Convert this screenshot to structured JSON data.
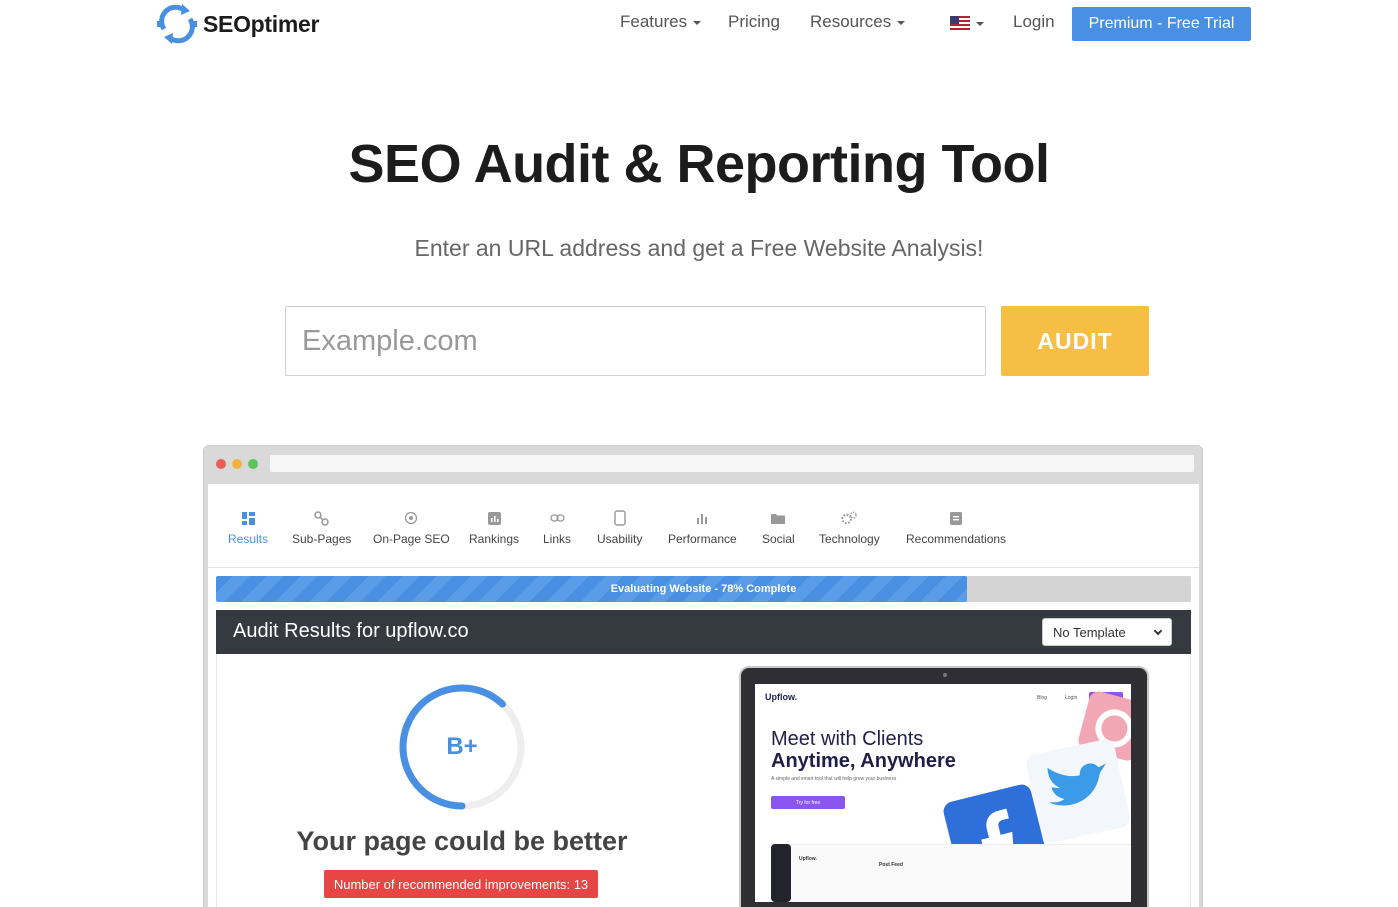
{
  "nav": {
    "logo_text": "SEOptimer",
    "features": "Features",
    "pricing": "Pricing",
    "resources": "Resources",
    "login": "Login",
    "premium": "Premium - Free Trial"
  },
  "hero": {
    "title": "SEO Audit & Reporting Tool",
    "subtitle": "Enter an URL address and get a Free Website Analysis!",
    "input_placeholder": "Example.com",
    "audit_label": "AUDIT"
  },
  "mock": {
    "tabs": [
      {
        "label": "Results",
        "icon": "dashboard-icon",
        "active": true
      },
      {
        "label": "Sub-Pages",
        "icon": "link-nodes-icon"
      },
      {
        "label": "On-Page SEO",
        "icon": "target-icon"
      },
      {
        "label": "Rankings",
        "icon": "bar-chart-icon"
      },
      {
        "label": "Links",
        "icon": "chain-link-icon"
      },
      {
        "label": "Usability",
        "icon": "tablet-icon"
      },
      {
        "label": "Performance",
        "icon": "signal-bars-icon"
      },
      {
        "label": "Social",
        "icon": "folder-icon"
      },
      {
        "label": "Technology",
        "icon": "gears-icon"
      },
      {
        "label": "Recommendations",
        "icon": "clipboard-icon"
      }
    ],
    "progress_text": "Evaluating Website - 78% Complete",
    "progress_value": 0.77,
    "results_title": "Audit Results for upflow.co",
    "template_select": "No Template",
    "grade": "B+",
    "grade_fraction": 0.62,
    "verdict": "Your page could be better",
    "improvements": "Number of recommended improvements: 13",
    "upflow": {
      "logo": "Upflow.",
      "nav_blog": "Blog",
      "nav_login": "Login",
      "nav_try": "Try for free",
      "headline1": "Meet with Clients",
      "headline2": "Anytime, Anywhere",
      "tagline": "A simple and smart tool that will help grow your business",
      "cta": "Try for free",
      "panel_logo": "Upflow.",
      "panel_title": "Post Feed"
    }
  },
  "colors": {
    "accent": "#4a90e2",
    "audit": "#f7be45",
    "danger": "#e84545",
    "dark_bar": "#343a40"
  }
}
